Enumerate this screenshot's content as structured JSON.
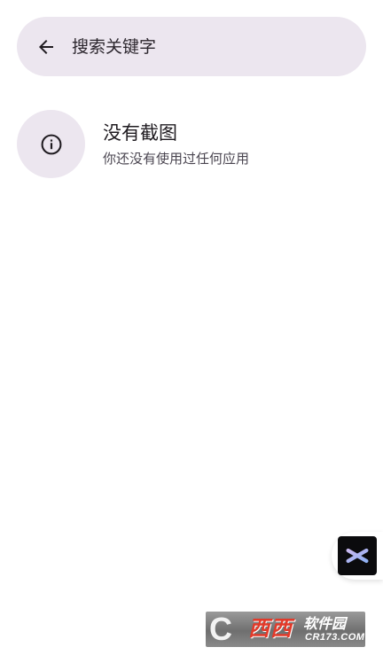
{
  "search": {
    "placeholder": "搜索关键字",
    "value": "",
    "back_icon": "arrow-left-icon"
  },
  "empty_state": {
    "icon": "info-icon",
    "title": "没有截图",
    "subtitle": "你还没有使用过任何应用"
  },
  "floating_widget": {
    "icon": "snowflake-asterisk-icon"
  },
  "watermark": {
    "letter": "C",
    "brand": "西西",
    "soft": "软件园",
    "domain": "CR173.COM"
  },
  "colors": {
    "surface_tint": "#ece6ef",
    "text_primary": "#1f1b20",
    "text_secondary": "#4a4550",
    "float_icon_bg": "#0b0b0d",
    "watermark_brand": "#e23a2a"
  }
}
